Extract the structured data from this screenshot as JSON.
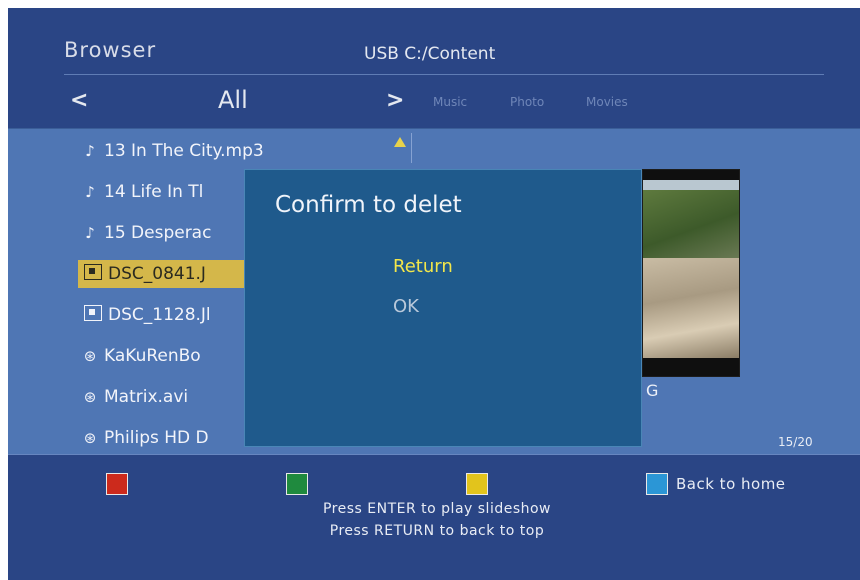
{
  "header": {
    "title": "Browser",
    "path": "USB  C:/Content",
    "nav_prev": "<",
    "nav_next": ">",
    "current_filter": "All",
    "filters": [
      "Music",
      "Photo",
      "Movies"
    ]
  },
  "file_list": [
    {
      "icon": "music-note-icon",
      "glyph": "♪",
      "label": "13 In The City.mp3"
    },
    {
      "icon": "music-note-icon",
      "glyph": "♪",
      "label": "14 Life In Tl"
    },
    {
      "icon": "music-note-icon",
      "glyph": "♪",
      "label": "15 Desperac"
    },
    {
      "icon": "photo-icon",
      "glyph": "",
      "label": "DSC_0841.J"
    },
    {
      "icon": "photo-icon",
      "glyph": "",
      "label": "DSC_1128.Jl"
    },
    {
      "icon": "film-reel-icon",
      "glyph": "⊛",
      "label": "KaKuRenBo"
    },
    {
      "icon": "film-reel-icon",
      "glyph": "⊛",
      "label": "Matrix.avi"
    },
    {
      "icon": "film-reel-icon",
      "glyph": "⊛",
      "label": "Philips HD D"
    }
  ],
  "preview": {
    "file_info": "G",
    "page_count": "15/20"
  },
  "dialog": {
    "title": "Confirm to delet",
    "options": [
      "Return",
      "OK"
    ],
    "selected_option": "Return"
  },
  "footer": {
    "key_colors": {
      "red": "#cc2a1c",
      "green": "#1f8a3e",
      "yellow": "#e2c41c",
      "blue": "#2b96d6"
    },
    "blue_key_label": "Back to home",
    "hints": [
      "Press ENTER to play slideshow",
      "Press RETURN to back to top"
    ]
  }
}
